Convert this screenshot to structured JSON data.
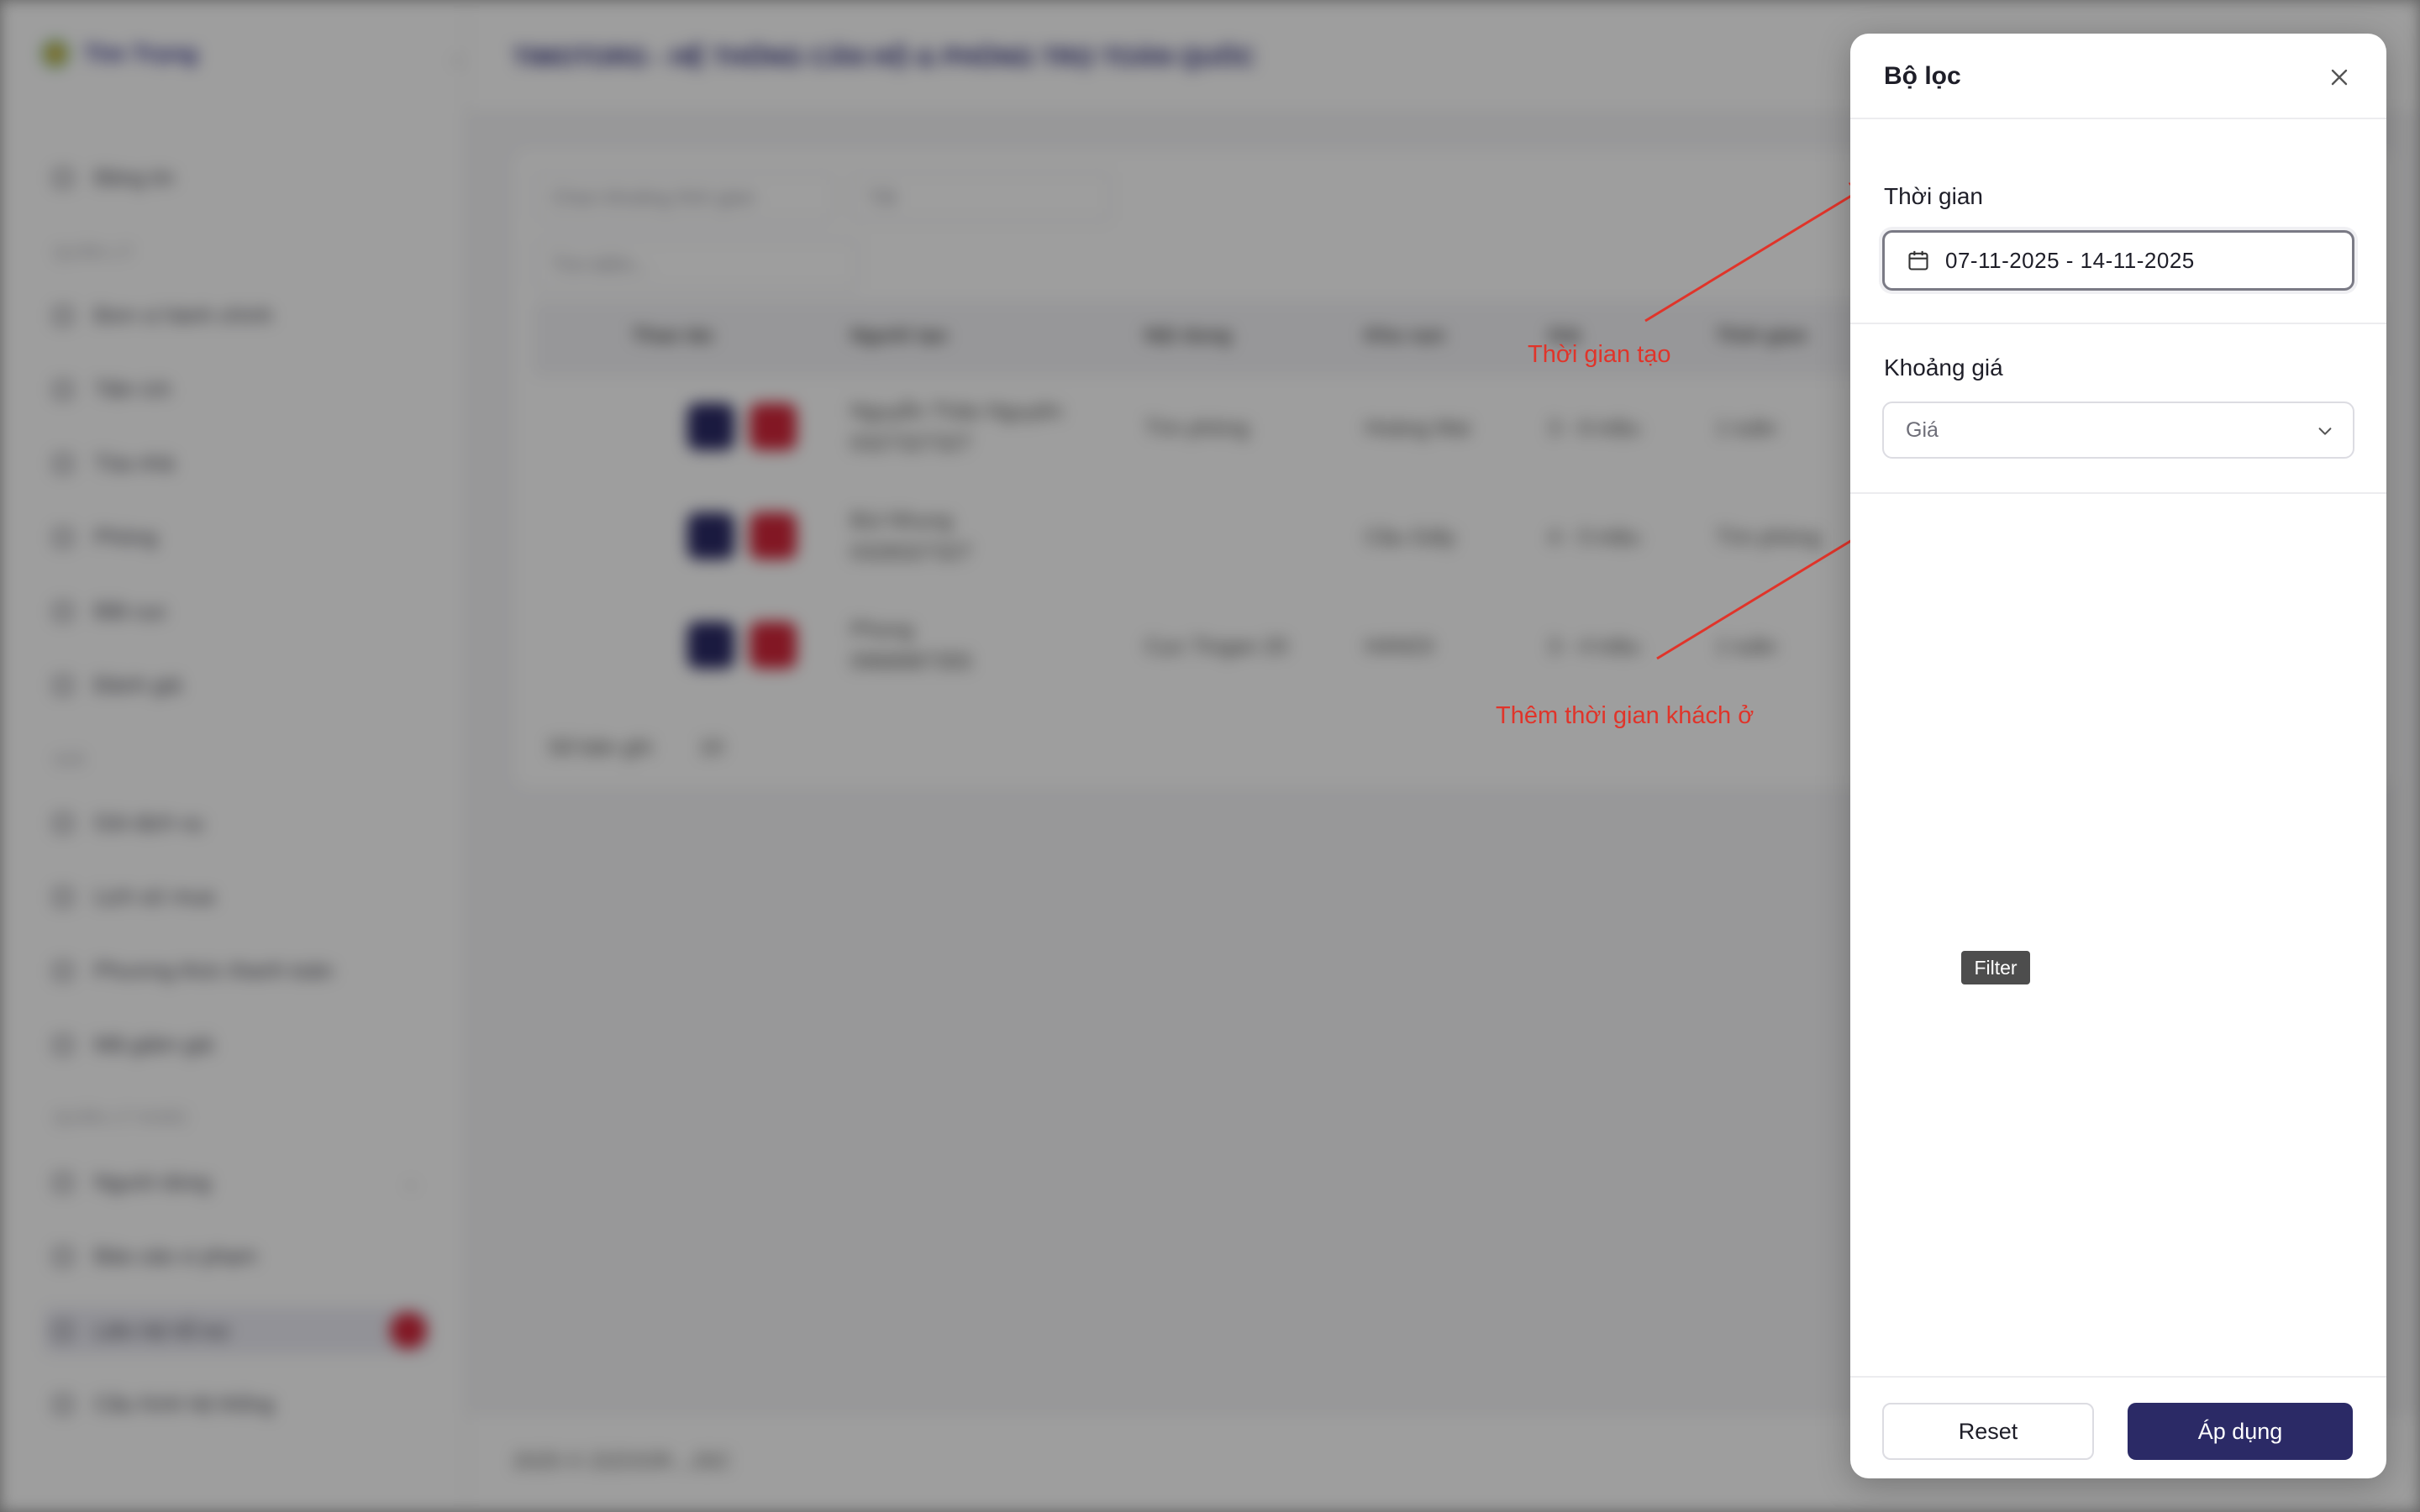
{
  "background": {
    "brand": "Tìm Trọng",
    "header_title": "TIMOTORG - HỆ THỐNG CĂN HỘ & PHÒNG TRỌ TOÀN QUỐC",
    "sidebar": {
      "items_top": [
        "Bảng tin"
      ],
      "group_1": "QUẢN LÝ",
      "items_1": [
        "Đơn vị hành chính",
        "Tiện ích",
        "Tòa nhà",
        "Phòng",
        "Bất cục",
        "Đánh giá"
      ],
      "group_2": "GIÁ",
      "items_2": [
        "Gói dịch vụ",
        "Lịch sử mua",
        "Phương thức thanh toán",
        "Mã giảm giá"
      ],
      "group_3": "QUẢN LÝ KHÁC",
      "items_3": [
        "Người dùng",
        "Báo cáo vi phạm",
        "Liên hệ hỗ trợ",
        "Cấu hình hệ thống"
      ]
    },
    "filters": {
      "time_placeholder": "Chọn khoảng thời gian",
      "status": "Tất",
      "search_placeholder": "Tìm kiếm..."
    },
    "table": {
      "headers": [
        "Thao tác",
        "Người tạo",
        "Nội dung",
        "Khu vực",
        "Giá",
        "Thời gian"
      ],
      "rows": [
        {
          "creator": "Nguyễn Thảo Nguyên",
          "phone": "0327327327",
          "content": "Tìm phòng",
          "area": "Hoàng Mai",
          "price": "3 - 6 triệu",
          "time": "1 tuần"
        },
        {
          "creator": "Bùi Nhung",
          "phone": "0328327327",
          "content": "",
          "area": "Cầu Giấy",
          "price": "4 - 5 triệu",
          "time": "Tìm phòng"
        },
        {
          "creator": "Phong",
          "phone": "0968987355",
          "content": "Cực Tingan 20",
          "area": "HANOI",
          "price": "3 - 4 triệu",
          "time": "1 tuần"
        }
      ],
      "page_size_label": "Số bản ghi",
      "page_size": "10"
    },
    "footer": "2025 © ZIZOOR...JSC"
  },
  "drawer": {
    "title": "Bộ lọc",
    "time_label": "Thời gian",
    "date_range": "07-11-2025 - 14-11-2025",
    "price_label": "Khoảng giá",
    "price_placeholder": "Giá",
    "reset_label": "Reset",
    "apply_label": "Áp dụng",
    "tooltip": "Filter"
  },
  "annotations": {
    "note_1": "Thời gian tạo",
    "note_2": "Thêm thời gian khách ở",
    "color": "#e0342a"
  },
  "colors": {
    "primary": "#2b2a66",
    "danger": "#d2263a"
  }
}
